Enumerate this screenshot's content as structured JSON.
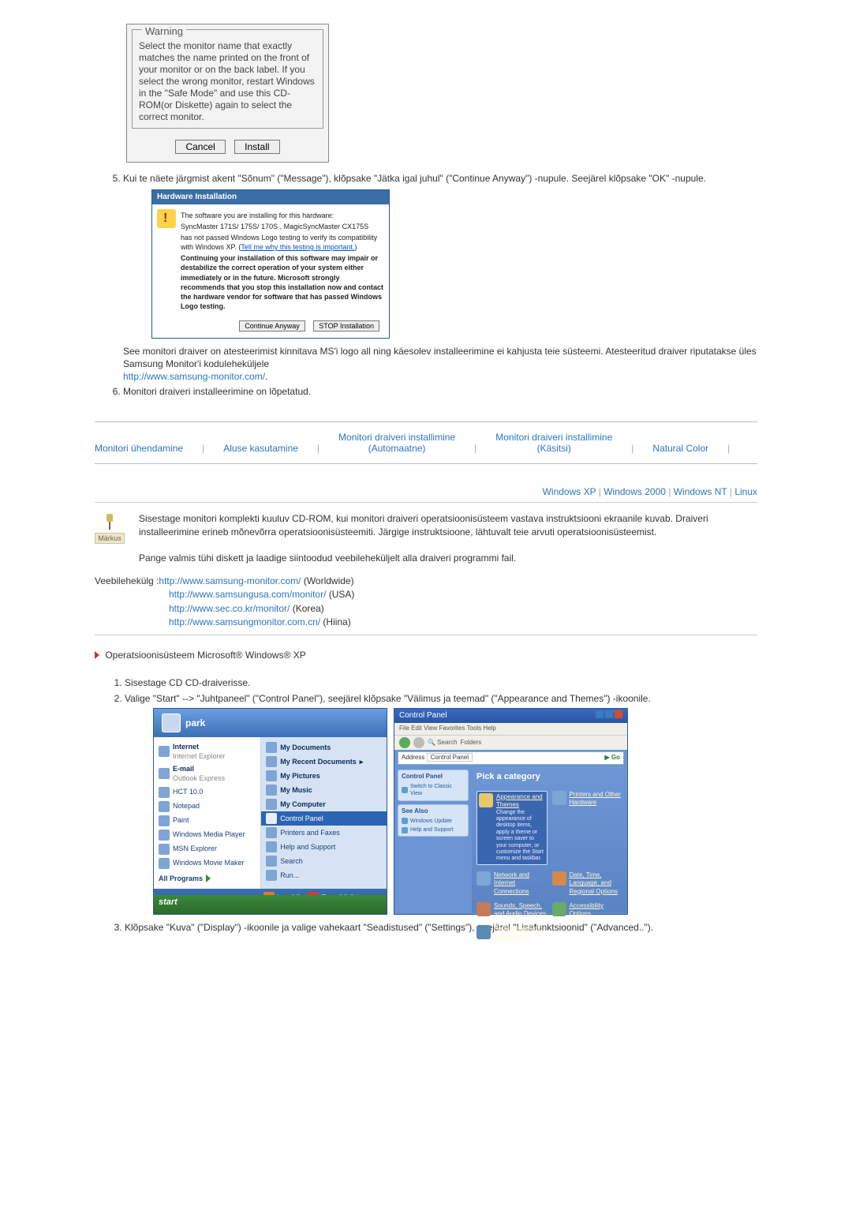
{
  "warning": {
    "legend": "Warning",
    "body": "Select the monitor name that exactly matches the name printed on the front of your monitor or on the back label. If you select the wrong monitor, restart Windows in the \"Safe Mode\" and use this CD-ROM(or Diskette) again to select the correct monitor.",
    "cancel": "Cancel",
    "install": "Install"
  },
  "step5": {
    "text": "Kui te näete järgmist akent \"Sõnum\" (\"Message\"), klõpsake \"Jätka igal juhul\" (\"Continue Anyway\") -nupule. Seejärel klõpsake \"OK\" -nupule."
  },
  "hw": {
    "title": "Hardware Installation",
    "l1": "The software you are installing for this hardware:",
    "l2": "SyncMaster 171S/ 175S/ 170S , MagicSyncMaster CX175S",
    "l3a": "has not passed Windows Logo testing to verify its compatibility with Windows XP. (",
    "l3link": "Tell me why this testing is important.",
    "l3b": ")",
    "l4": "Continuing your installation of this software may impair or destabilize the correct operation of your system either immediately or in the future. Microsoft strongly recommends that you stop this installation now and contact the hardware vendor for software that has passed Windows Logo testing.",
    "btn_cont": "Continue Anyway",
    "btn_stop": "STOP Installation"
  },
  "after5": {
    "p1": "See monitori draiver on atesteerimist kinnitava MS'i logo all ning käesolev installeerimine ei kahjusta teie süsteemi. Atesteeritud draiver riputatakse üles Samsung Monitor'i koduleheküljele",
    "url": "http://www.samsung-monitor.com/",
    "dot": "."
  },
  "step6": "Monitori draiveri installeerimine on lõpetatud.",
  "tabs": {
    "t1": "Monitori ühendamine",
    "t2": "Aluse kasutamine",
    "t3": "Monitori draiveri installimine",
    "t3s": "(Automaatne)",
    "t4": "Monitori draiveri installimine",
    "t4s": "(Käsitsi)",
    "t5": "Natural Color"
  },
  "oslinks": {
    "xp": "Windows XP",
    "w2k": "Windows 2000",
    "nt": "Windows NT",
    "lin": "Linux"
  },
  "note": {
    "label": "Märkus",
    "text": "Sisestage monitori komplekti kuuluv CD-ROM, kui monitori draiveri operatsioonisüsteem vastava instruktsiooni ekraanile kuvab. Draiveri installeerimine erineb mõnevõrra operatsioonisüsteemiti. Järgige instruktsioone, lähtuvalt teie arvuti operatsioonisüsteemist.",
    "p2": "Pange valmis tühi diskett ja laadige siintoodud veebileheküljelt alla draiveri programmi fail."
  },
  "veeb": {
    "label": "Veebilehekülg :",
    "u1": "http://www.samsung-monitor.com/",
    "u1t": " (Worldwide)",
    "u2": "http://www.samsungusa.com/monitor/",
    "u2t": " (USA)",
    "u3": "http://www.sec.co.kr/monitor/",
    "u3t": " (Korea)",
    "u4": "http://www.samsungmonitor.com.cn/",
    "u4t": " (Hiina)"
  },
  "osheading": "Operatsioonisüsteem Microsoft® Windows® XP",
  "steps": {
    "s1": "Sisestage CD CD-draiverisse.",
    "s2": "Valige \"Start\" --> \"Juhtpaneel\" (\"Control Panel\"), seejärel klõpsake \"Välimus ja teemad\" (\"Appearance and Themes\") -ikoonile.",
    "s3": "Klõpsake \"Kuva\" (\"Display\") -ikoonile ja valige vahekaart \"Seadistused\" (\"Settings\"), seejärel \"Lisafunktsioonid\" (\"Advanced..\")."
  },
  "startmenu": {
    "user": "park",
    "left": {
      "internet": "Internet",
      "internet_sub": "Internet Explorer",
      "email": "E-mail",
      "email_sub": "Outlook Express",
      "hct": "HCT 10.0",
      "notepad": "Notepad",
      "paint": "Paint",
      "wmp": "Windows Media Player",
      "msn": "MSN Explorer",
      "movie": "Windows Movie Maker",
      "all": "All Programs"
    },
    "right": {
      "mydocs": "My Documents",
      "recent": "My Recent Documents",
      "pics": "My Pictures",
      "music": "My Music",
      "mycomp": "My Computer",
      "cpanel": "Control Panel",
      "printers": "Printers and Faxes",
      "help": "Help and Support",
      "search": "Search",
      "run": "Run..."
    },
    "logoff": "Log Off",
    "turnoff": "Turn Off Computer",
    "start": "start"
  },
  "cpanel": {
    "title": "Control Panel",
    "menu": "File   Edit   View   Favorites   Tools   Help",
    "addr_label": "Address",
    "addr": "Control Panel",
    "go": "Go",
    "side_t": "Control Panel",
    "side1": "Switch to Classic View",
    "side_see": "See Also",
    "side2": "Windows Update",
    "side3": "Help and Support",
    "pick": "Pick a category",
    "cat1": "Appearance and Themes",
    "cat1d": "Change the appearance of desktop items, apply a theme or screen saver to your computer, or customize the Start menu and taskbar.",
    "cat2": "Printers and Other Hardware",
    "cat3": "Network and Internet Connections",
    "cat4": "Date, Time, Language, and Regional Options",
    "cat5": "Sounds, Speech, and Audio Devices",
    "cat6": "Accessibility Options",
    "cat7": "Performance and Maintenance"
  }
}
